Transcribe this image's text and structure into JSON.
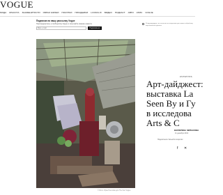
{
  "header": {
    "logo": "VOGUE",
    "nav": [
      "МОДА",
      "КРАСОТА",
      "ЗНАМЕНИТОСТИ",
      "ОБРАЗ ЖИЗНИ",
      "ПОКУПКИ",
      "ПРАЗДНИКИ",
      "LOOKFLIX",
      "ВИДЕО",
      "ПОДКАСТ",
      "АВТО",
      "КРИС",
      "VOGUE"
    ]
  },
  "subscribe": {
    "title": "Подписка на нашу рассылку Vogue",
    "text": "Присоединитесь к сообществу Vogue и получайте свежие новости",
    "placeholder": "Ваш e-mail",
    "button": "Подписаться",
    "consent": "Я подтверждаю, что согласен на получение рассылки и обработку персональных данных"
  },
  "article": {
    "rubric": "КУЛЬТУРА",
    "headline_lines": [
      "Арт-дайджест:",
      "выставка La",
      "Seen By и Гу",
      "в исследова",
      "Arts & C"
    ],
    "author": "ЕКАТЕРИНА ЧЕРКАСОВА",
    "date": "11 декабря 2019",
    "share_label": "Поделиться статьей в соцсетях",
    "photo_credit": "© Фото: Ирэн Пештова для The Sun Vogue"
  },
  "icons": {
    "facebook": "facebook-icon",
    "vk": "vk-icon"
  }
}
